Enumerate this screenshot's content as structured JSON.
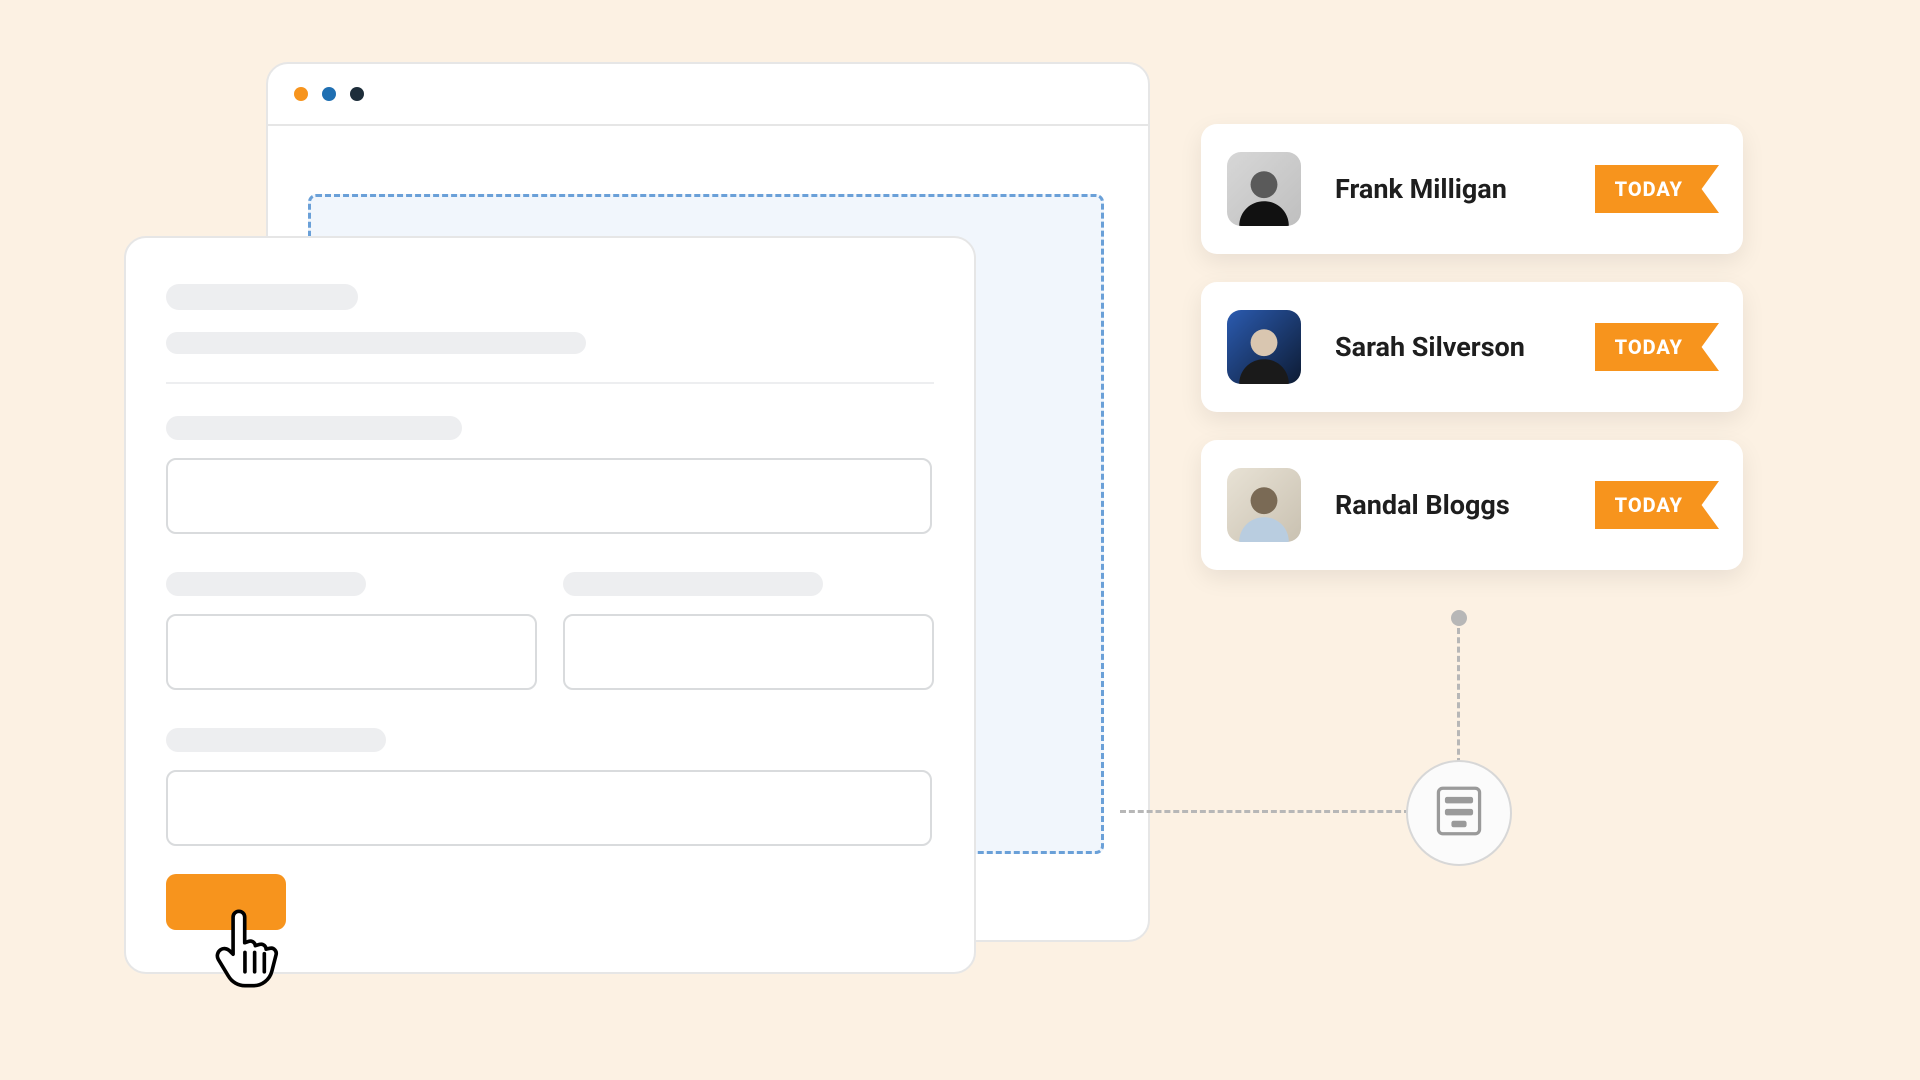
{
  "users": [
    {
      "name": "Frank Milligan",
      "badge": "TODAY"
    },
    {
      "name": "Sarah Silverson",
      "badge": "TODAY"
    },
    {
      "name": "Randal Bloggs",
      "badge": "TODAY"
    }
  ],
  "colors": {
    "accent": "#f7941d",
    "canvas": "#fcf1e3",
    "dropzone_border": "#6aa0d8"
  }
}
